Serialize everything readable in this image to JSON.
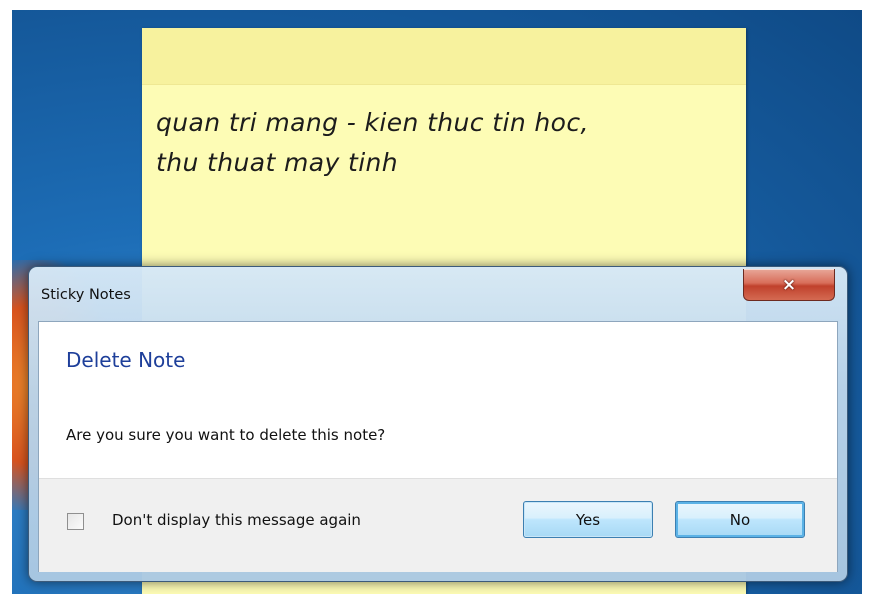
{
  "sticky_note": {
    "line1": "quan tri mang - kien thuc tin hoc,",
    "line2": "thu thuat may tinh",
    "color": "#fdfcb5"
  },
  "dialog": {
    "title": "Sticky Notes",
    "close_icon": "×",
    "main_instruction": "Delete Note",
    "message": "Are you sure you want to delete this note?",
    "checkbox_label": "Don't display this message again",
    "checkbox_checked": false,
    "yes_label": "Yes",
    "no_label": "No",
    "accent_color": "#1e3f9a"
  }
}
